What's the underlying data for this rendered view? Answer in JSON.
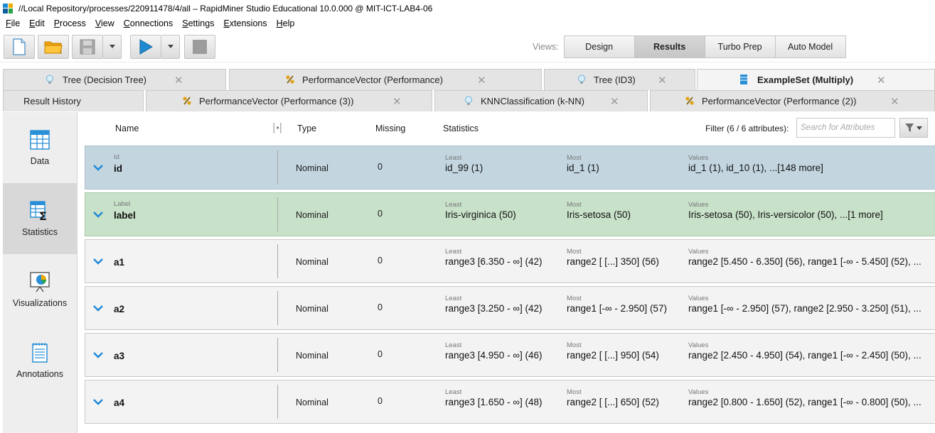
{
  "window": {
    "title": "//Local Repository/processes/220911478/4/all – RapidMiner Studio Educational 10.0.000 @ MIT-ICT-LAB4-06",
    "icon_colors": [
      "#1f8ad1",
      "#f2a900",
      "#0f5e9e",
      "#2aa346"
    ]
  },
  "menu": {
    "items": [
      {
        "first": "F",
        "rest": "ile"
      },
      {
        "first": "E",
        "rest": "dit"
      },
      {
        "first": "P",
        "rest": "rocess"
      },
      {
        "first": "V",
        "rest": "iew"
      },
      {
        "first": "C",
        "rest": "onnections"
      },
      {
        "first": "S",
        "rest": "ettings"
      },
      {
        "first": "E",
        "rest": "xtensions"
      },
      {
        "first": "H",
        "rest": "elp"
      }
    ]
  },
  "toolbar": {
    "buttons": [
      "new-process",
      "open-process",
      "save-process",
      "run-process",
      "stop-process"
    ]
  },
  "views": {
    "label": "Views:",
    "buttons": [
      "Design",
      "Results",
      "Turbo Prep",
      "Auto Model"
    ],
    "active": "Results"
  },
  "tabs": {
    "row1": [
      {
        "label": "Tree (Decision Tree)",
        "icon": "bulb-icon",
        "active": false
      },
      {
        "label": "PerformanceVector (Performance)",
        "icon": "percent-icon",
        "active": false
      },
      {
        "label": "Tree (ID3)",
        "icon": "bulb-icon",
        "active": false
      },
      {
        "label": "ExampleSet (Multiply)",
        "icon": "table-icon",
        "active": true
      }
    ],
    "row2": [
      {
        "label": "Result History",
        "icon": "",
        "active": false
      },
      {
        "label": "PerformanceVector (Performance (3))",
        "icon": "percent-icon",
        "active": false
      },
      {
        "label": "KNNClassification (k-NN)",
        "icon": "bulb-icon",
        "active": false
      },
      {
        "label": "PerformanceVector (Performance (2))",
        "icon": "percent-icon",
        "active": false
      }
    ],
    "close_glyph": "✕"
  },
  "sidebar": {
    "items": [
      {
        "label": "Data",
        "icon": "data-table-icon"
      },
      {
        "label": "Statistics",
        "icon": "statistics-icon"
      },
      {
        "label": "Visualizations",
        "icon": "visualizations-icon"
      },
      {
        "label": "Annotations",
        "icon": "annotations-icon"
      }
    ],
    "active": "Statistics"
  },
  "header": {
    "name": "Name",
    "resize_glyph": "│•│",
    "type": "Type",
    "missing": "Missing",
    "statistics": "Statistics",
    "filter": "Filter (6 / 6 attributes):",
    "search_placeholder": "Search for Attributes"
  },
  "captions": {
    "least": "Least",
    "most": "Most",
    "values": "Values"
  },
  "rows": [
    {
      "role": "Id",
      "name": "id",
      "type": "Nominal",
      "missing": "0",
      "least": "id_99 (1)",
      "most": "id_1 (1)",
      "values": "id_1 (1), id_10 (1), ...[148 more]"
    },
    {
      "role": "Label",
      "name": "label",
      "type": "Nominal",
      "missing": "0",
      "least": "Iris-virginica (50)",
      "most": "Iris-setosa (50)",
      "values": "Iris-setosa (50), Iris-versicolor (50), ...[1 more]"
    },
    {
      "role": "",
      "name": "a1",
      "type": "Nominal",
      "missing": "0",
      "least": "range3 [6.350 - ∞] (42)",
      "most": "range2 [ [...] 350] (56)",
      "values": "range2 [5.450 - 6.350] (56), range1 [-∞ - 5.450] (52), ..."
    },
    {
      "role": "",
      "name": "a2",
      "type": "Nominal",
      "missing": "0",
      "least": "range3 [3.250 - ∞] (42)",
      "most": "range1 [-∞ - 2.950] (57)",
      "values": "range1 [-∞ - 2.950] (57), range2 [2.950 - 3.250] (51), ..."
    },
    {
      "role": "",
      "name": "a3",
      "type": "Nominal",
      "missing": "0",
      "least": "range3 [4.950 - ∞] (46)",
      "most": "range2 [ [...] 950] (54)",
      "values": "range2 [2.450 - 4.950] (54), range1 [-∞ - 2.450] (50), ..."
    },
    {
      "role": "",
      "name": "a4",
      "type": "Nominal",
      "missing": "0",
      "least": "range3 [1.650 - ∞] (48)",
      "most": "range2 [ [...] 650] (52)",
      "values": "range2 [0.800 - 1.650] (52), range1 [-∞ - 0.800] (50), ..."
    }
  ],
  "colors": {
    "id_row": "#c3d6e0",
    "label_row": "#c8e1c9",
    "regular_row": "#f3f3f3",
    "chevron": "#1e88d6",
    "run": "#1f8ad1"
  }
}
